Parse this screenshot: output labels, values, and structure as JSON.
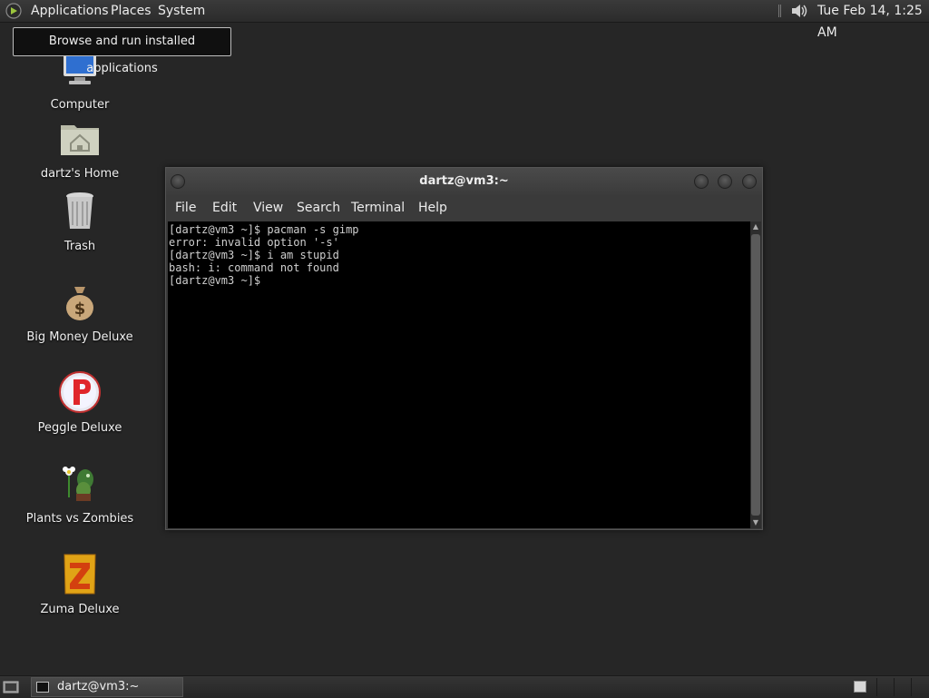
{
  "top_panel": {
    "menus": [
      "Applications",
      "Places",
      "System"
    ],
    "clock": "Tue Feb 14,  1:25 AM",
    "icons": {
      "apps": "gnome-foot-icon",
      "audio": "speaker-volume-icon"
    }
  },
  "tooltip": "Browse and run installed applications",
  "desktop_icons": [
    {
      "label": "Computer",
      "icon": "computer-icon"
    },
    {
      "label": "dartz's Home",
      "icon": "home-folder-icon"
    },
    {
      "label": "Trash",
      "icon": "trash-icon"
    },
    {
      "label": "Big Money Deluxe",
      "icon": "money-bag-icon"
    },
    {
      "label": "Peggle Deluxe",
      "icon": "peggle-icon"
    },
    {
      "label": "Plants vs Zombies",
      "icon": "plants-vs-zombies-icon"
    },
    {
      "label": "Zuma Deluxe",
      "icon": "zuma-icon"
    }
  ],
  "terminal": {
    "title": "dartz@vm3:~",
    "menus": [
      "File",
      "Edit",
      "View",
      "Search",
      "Terminal",
      "Help"
    ],
    "lines": [
      "[dartz@vm3 ~]$ pacman -s gimp",
      "error: invalid option '-s'",
      "[dartz@vm3 ~]$ i am stupid",
      "bash: i: command not found",
      "[dartz@vm3 ~]$ "
    ]
  },
  "bottom_panel": {
    "task_label": "dartz@vm3:~"
  },
  "colors": {
    "desktop_bg": "#262626",
    "terminal_bg": "#000000",
    "terminal_text": "#cfcfcf"
  }
}
